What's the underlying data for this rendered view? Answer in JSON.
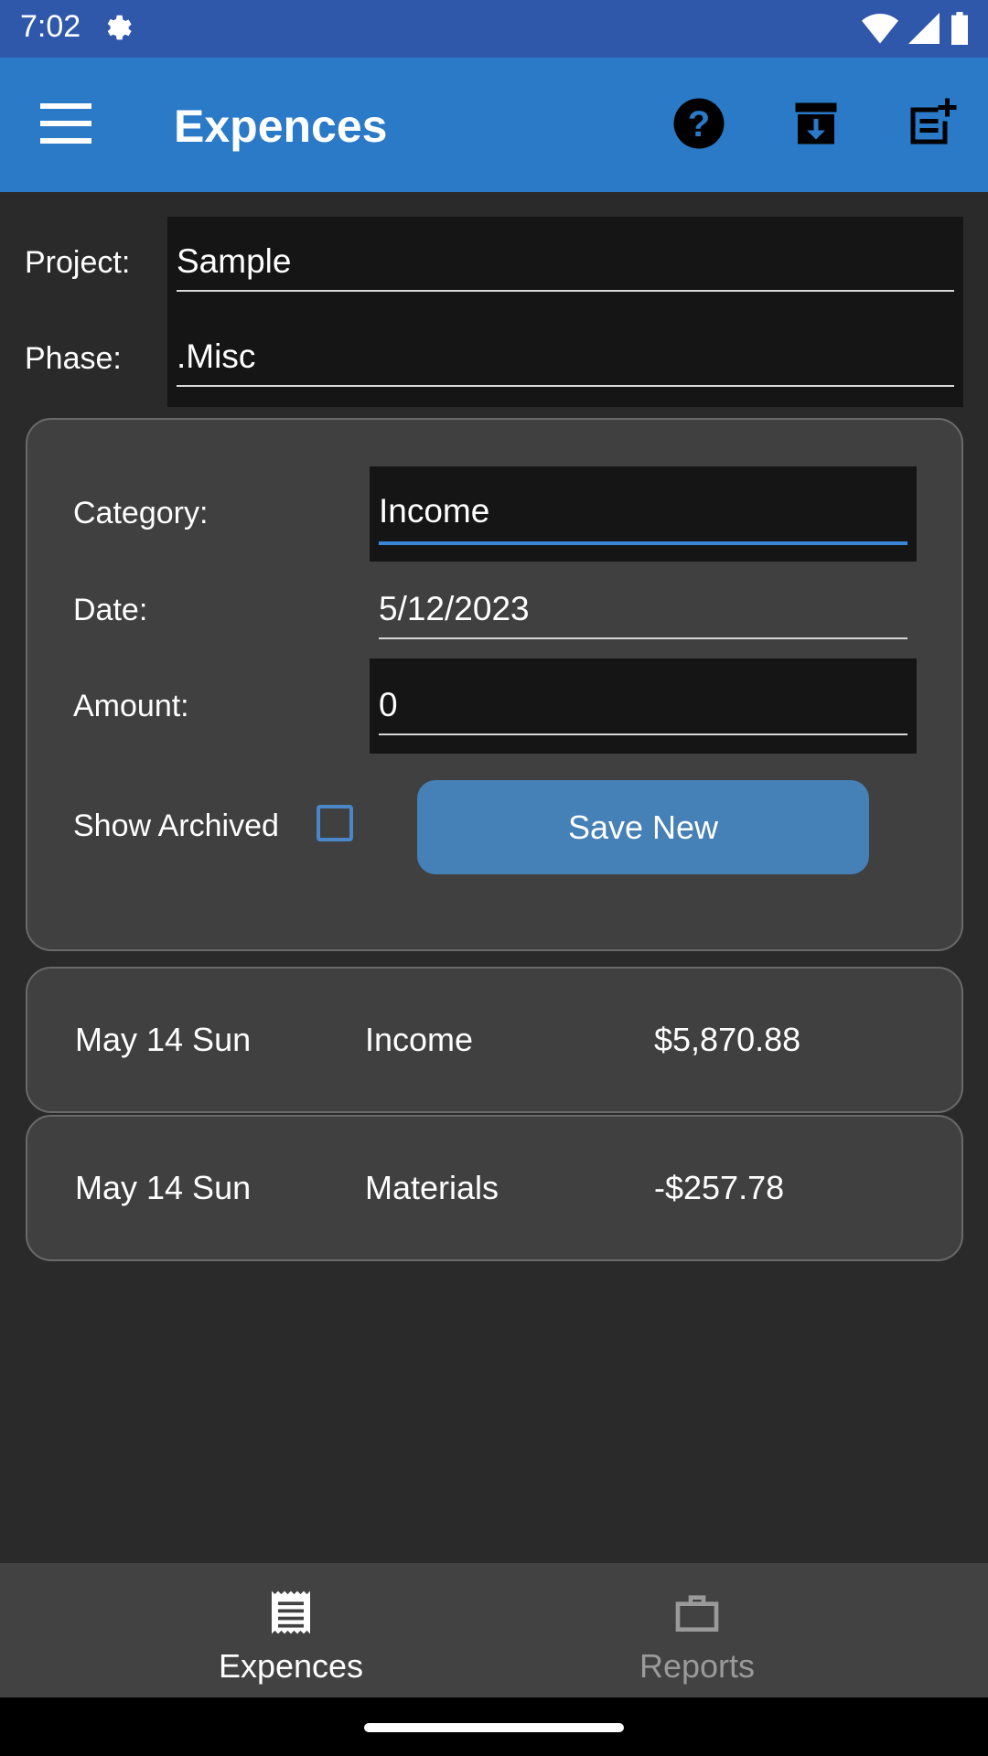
{
  "status_bar": {
    "time": "7:02"
  },
  "app_bar": {
    "title": "Expences",
    "icons": [
      "menu-icon",
      "help-icon",
      "archive-download-icon",
      "add-note-icon"
    ]
  },
  "form": {
    "project_label": "Project:",
    "project_value": "Sample",
    "phase_label": "Phase:",
    "phase_value": ".Misc",
    "category_label": "Category:",
    "category_value": "Income",
    "date_label": "Date:",
    "date_value": "5/12/2023",
    "amount_label": "Amount:",
    "amount_value": "0",
    "show_archived_label": "Show Archived",
    "show_archived_checked": false,
    "save_button": "Save New"
  },
  "entries": [
    {
      "date": "May 14 Sun",
      "category": "Income",
      "amount": "$5,870.88"
    },
    {
      "date": "May 14 Sun",
      "category": "Materials",
      "amount": "-$257.78"
    }
  ],
  "bottom_nav": {
    "tabs": [
      {
        "label": "Expences",
        "icon": "receipt-icon",
        "active": true
      },
      {
        "label": "Reports",
        "icon": "briefcase-icon",
        "active": false
      }
    ]
  },
  "colors": {
    "status_bar": "#3058aa",
    "app_bar": "#2a7ac8",
    "background": "#2a2a2a",
    "card": "#404040",
    "accent": "#4580b6"
  }
}
